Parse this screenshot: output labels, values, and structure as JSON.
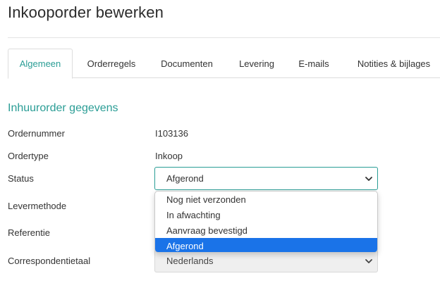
{
  "page": {
    "title": "Inkooporder bewerken"
  },
  "tabs": [
    {
      "label": "Algemeen",
      "active": true
    },
    {
      "label": "Orderregels",
      "active": false
    },
    {
      "label": "Documenten",
      "active": false
    },
    {
      "label": "Levering",
      "active": false
    },
    {
      "label": "E-mails",
      "active": false
    },
    {
      "label": "Notities & bijlages",
      "active": false
    }
  ],
  "section": {
    "title": "Inhuurorder gegevens"
  },
  "fields": {
    "ordernummer": {
      "label": "Ordernummer",
      "value": "I103136"
    },
    "ordertype": {
      "label": "Ordertype",
      "value": "Inkoop"
    },
    "status": {
      "label": "Status",
      "value": "Afgerond"
    },
    "levermethode": {
      "label": "Levermethode"
    },
    "referentie": {
      "label": "Referentie"
    },
    "correspondentietaal": {
      "label": "Correspondentietaal",
      "value": "Nederlands"
    }
  },
  "status_dropdown": {
    "options": [
      "Nog niet verzonden",
      "In afwachting",
      "Aanvraag bevestigd",
      "Afgerond"
    ],
    "selected": "Afgerond"
  },
  "colors": {
    "accent": "#2a9d95",
    "selected_option": "#1a73e8"
  },
  "icons": {
    "select_chevron": "chevron-down-icon"
  }
}
